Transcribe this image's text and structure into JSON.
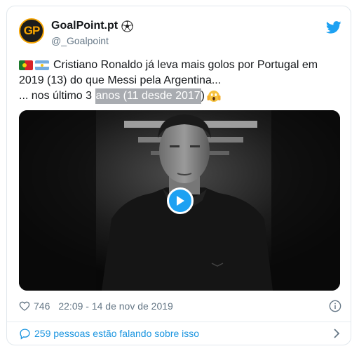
{
  "tweet": {
    "avatar_text": "GP",
    "display_name": "GoalPoint.pt",
    "handle": "@_Goalpoint",
    "text_line1": "Cristiano Ronaldo já leva mais golos por Portugal em",
    "text_line2": "2019 (13) do que Messi pela Argentina...",
    "text_line3_prefix": "... nos último 3 ",
    "text_line3_highlight": "anos (11 desde 2017",
    "text_line3_suffix": ")",
    "likes": "746",
    "timestamp": "22:09 - 14 de nov de 2019",
    "conversation": "259 pessoas estão falando sobre isso"
  },
  "colors": {
    "link": "#1b95e0",
    "play_button": "#1da1f2",
    "secondary_text": "#657786",
    "highlight": "#a9acb1"
  },
  "icons": {
    "brand": "twitter-bird-icon",
    "like": "heart-icon",
    "info": "info-icon",
    "reply": "speech-bubble-icon",
    "more": "chevron-right-icon"
  }
}
